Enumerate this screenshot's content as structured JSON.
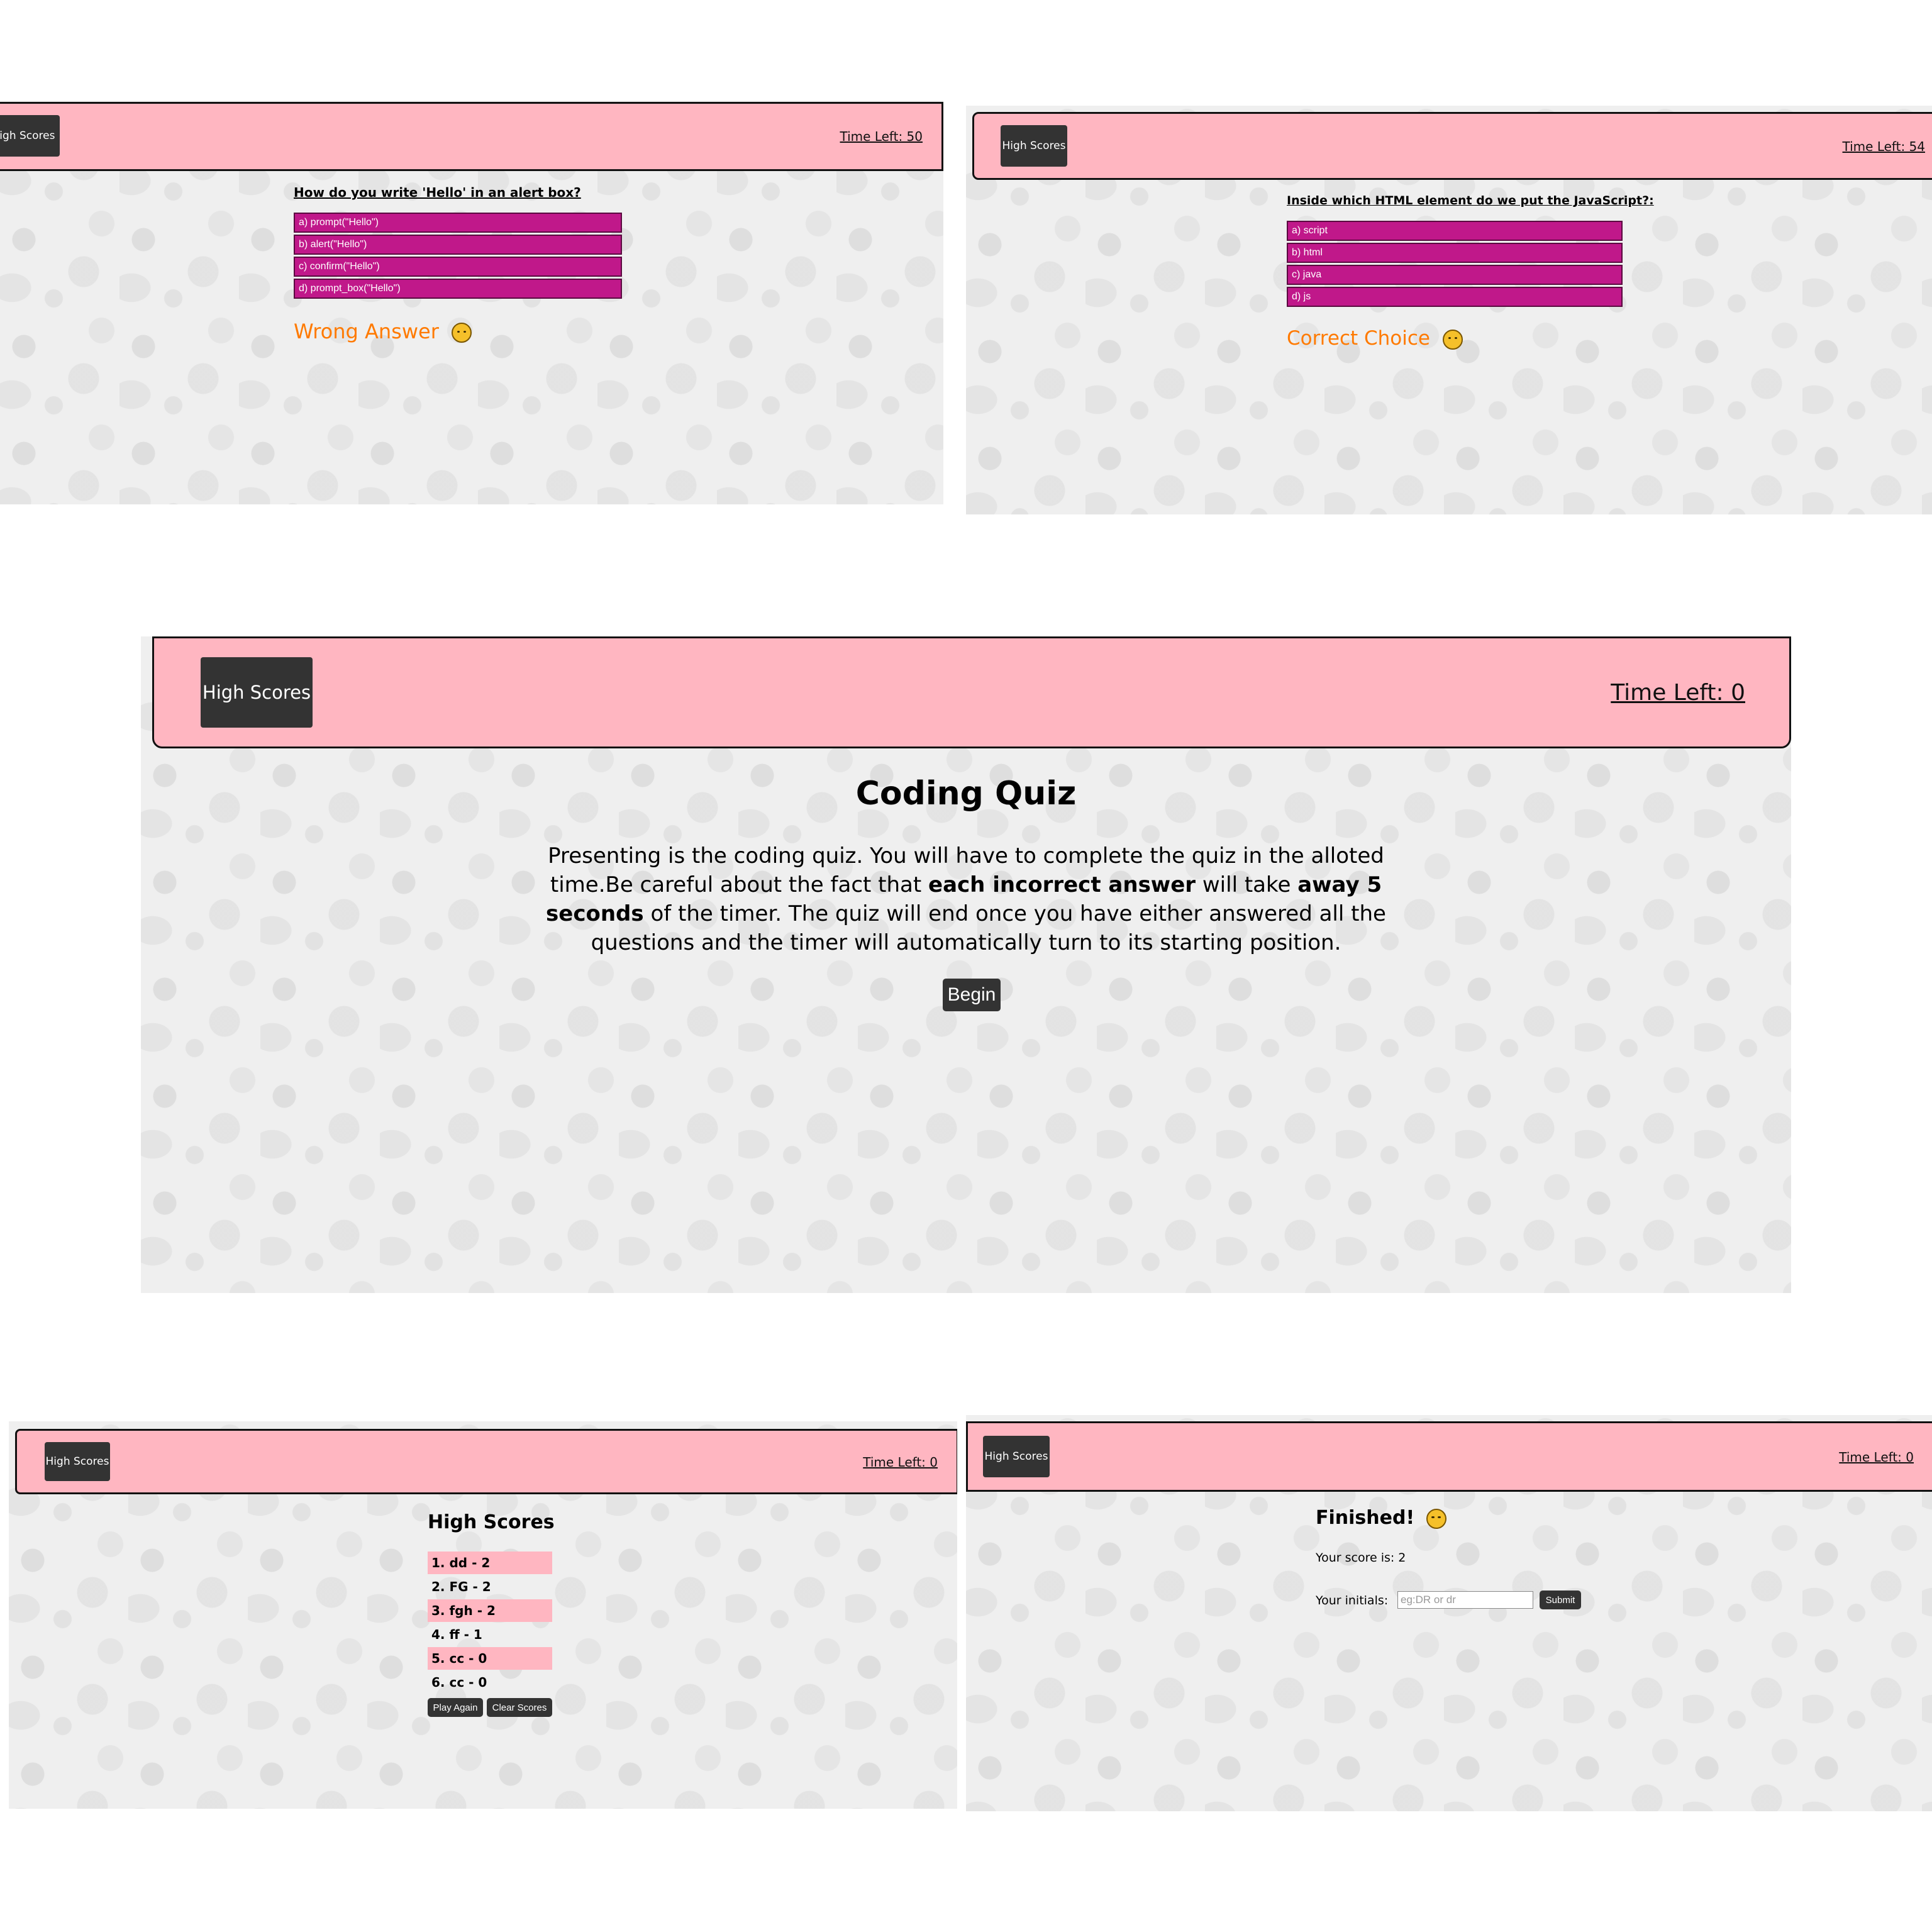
{
  "screens": {
    "wrong": {
      "header": {
        "high_scores": "High Scores",
        "time_left": "Time Left: 50"
      },
      "question": "How do you write 'Hello' in an alert box?",
      "answers": [
        "a) prompt(\"Hello\")",
        "b) alert(\"Hello\")",
        "c) confirm(\"Hello\")",
        "d) prompt_box(\"Hello\")"
      ],
      "feedback": "Wrong Answer",
      "feedback_icon": "sad-face-icon"
    },
    "correct": {
      "header": {
        "high_scores": "High Scores",
        "time_left": "Time Left: 54"
      },
      "question": "Inside which HTML element do we put the JavaScript?:",
      "answers": [
        "a) script",
        "b) html",
        "c) java",
        "d) js"
      ],
      "feedback": "Correct Choice",
      "feedback_icon": "smiling-face-icon"
    },
    "start": {
      "header": {
        "high_scores": "High Scores",
        "time_left": "Time Left: 0"
      },
      "title": "Coding Quiz",
      "intro_1": "Presenting is the coding quiz. You will have to complete the quiz in the alloted",
      "intro_2a": "time.Be careful about the fact that ",
      "intro_2b": "each incorrect answer",
      "intro_2c": " will take ",
      "intro_2d": "away 5",
      "intro_3a": "seconds",
      "intro_3b": " of the timer. The quiz will end once you have either answered all the",
      "intro_4": "questions and the timer will automatically turn to its starting position.",
      "begin": "Begin"
    },
    "scores": {
      "header": {
        "high_scores": "High Scores",
        "time_left": "Time Left: 0"
      },
      "title": "High Scores",
      "rows": [
        "1. dd - 2",
        "2. FG - 2",
        "3. fgh - 2",
        "4. ff - 1",
        "5. cc - 0",
        "6. cc - 0"
      ],
      "play_again": "Play Again",
      "clear_scores": "Clear Scores"
    },
    "finished": {
      "header": {
        "high_scores": "High Scores",
        "time_left": "Time Left: 0"
      },
      "title": "Finished!",
      "title_icon": "clapping-hands-icon",
      "score_text": "Your score is: 2",
      "initials_label": "Your initials:",
      "initials_placeholder": "eg:DR or dr",
      "initials_value": "",
      "submit": "Submit"
    }
  },
  "colors": {
    "header_bg": "#ffb6c1",
    "button_dark": "#333333",
    "answer_bg": "#c0188a",
    "feedback": "#ff7a00",
    "page_bg": "#efefef"
  }
}
